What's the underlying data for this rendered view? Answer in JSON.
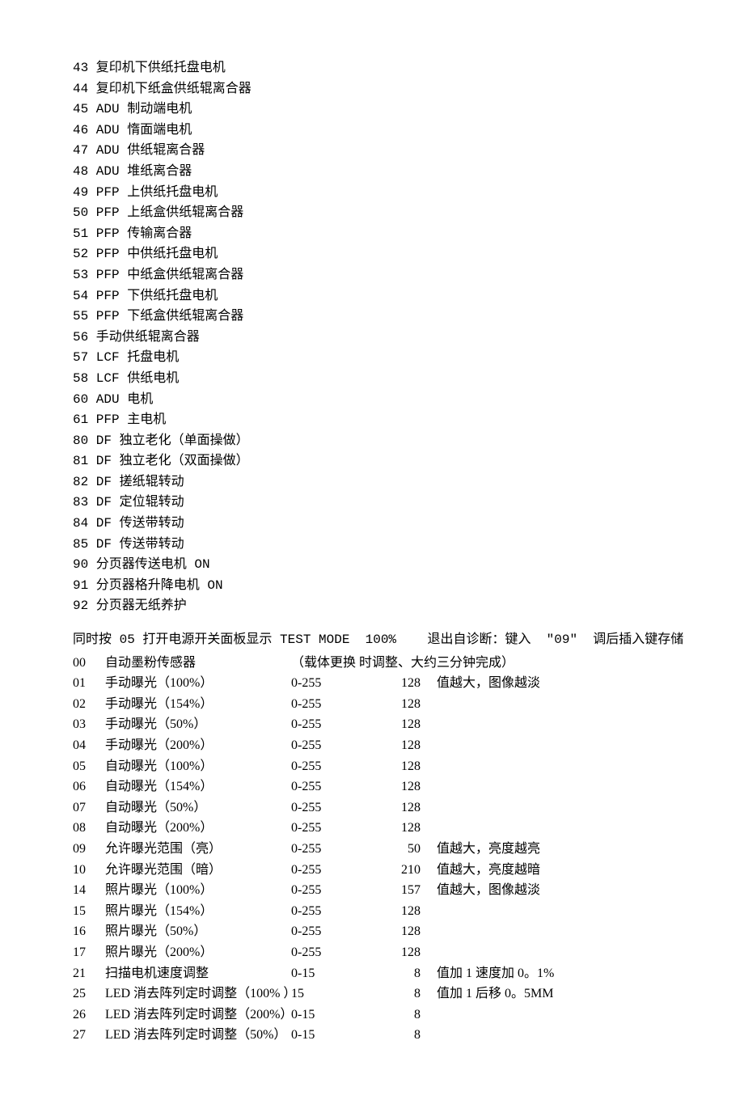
{
  "codes": [
    {
      "num": "43",
      "label": "复印机下供纸托盘电机"
    },
    {
      "num": "44",
      "label": "复印机下纸盒供纸辊离合器"
    },
    {
      "num": "45",
      "label": "ADU 制动端电机"
    },
    {
      "num": "46",
      "label": "ADU 惰面端电机"
    },
    {
      "num": "47",
      "label": "ADU 供纸辊离合器"
    },
    {
      "num": "48",
      "label": "ADU 堆纸离合器"
    },
    {
      "num": "49",
      "label": "PFP 上供纸托盘电机"
    },
    {
      "num": "50",
      "label": "PFP 上纸盒供纸辊离合器"
    },
    {
      "num": "51",
      "label": "PFP 传输离合器"
    },
    {
      "num": "52",
      "label": "PFP 中供纸托盘电机"
    },
    {
      "num": "53",
      "label": "PFP 中纸盒供纸辊离合器"
    },
    {
      "num": "54",
      "label": "PFP 下供纸托盘电机"
    },
    {
      "num": "55",
      "label": "PFP 下纸盒供纸辊离合器"
    },
    {
      "num": "56",
      "label": "手动供纸辊离合器"
    },
    {
      "num": "57",
      "label": "LCF 托盘电机"
    },
    {
      "num": "58",
      "label": "LCF 供纸电机"
    },
    {
      "num": "60",
      "label": "ADU 电机"
    },
    {
      "num": "61",
      "label": "PFP 主电机"
    },
    {
      "num": "80",
      "label": "DF 独立老化（单面操做）"
    },
    {
      "num": "81",
      "label": "DF 独立老化（双面操做）"
    },
    {
      "num": "82",
      "label": "DF 搓纸辊转动"
    },
    {
      "num": "83",
      "label": "DF 定位辊转动"
    },
    {
      "num": "84",
      "label": "DF 传送带转动"
    },
    {
      "num": "85",
      "label": "DF 传送带转动"
    },
    {
      "num": "90",
      "label": "分页器传送电机 ON"
    },
    {
      "num": "91",
      "label": "分页器格升降电机 ON"
    },
    {
      "num": "92",
      "label": "分页器无纸养护"
    }
  ],
  "section_header": "同时按 05 打开电源开关面板显示 TEST MODE  100%    退出自诊断：键入  \"09\"  调后插入键存储",
  "first_row": {
    "code": "00",
    "name": "自动墨粉传感器",
    "remark": "（载体更换  时调整、大约三分钟完成）"
  },
  "params": [
    {
      "code": "01",
      "name": "手动曝光（100%）",
      "range": "0-255",
      "default": "128",
      "remark": "值越大，图像越淡"
    },
    {
      "code": "02",
      "name": "手动曝光（154%）",
      "range": "0-255",
      "default": "128",
      "remark": ""
    },
    {
      "code": "03",
      "name": "手动曝光（50%）",
      "range": "0-255",
      "default": "128",
      "remark": ""
    },
    {
      "code": "04",
      "name": "手动曝光（200%）",
      "range": "0-255",
      "default": "128",
      "remark": ""
    },
    {
      "code": "05",
      "name": "自动曝光（100%）",
      "range": "0-255",
      "default": "128",
      "remark": ""
    },
    {
      "code": "06",
      "name": "自动曝光（154%）",
      "range": "0-255",
      "default": "128",
      "remark": ""
    },
    {
      "code": "07",
      "name": "自动曝光（50%）",
      "range": "0-255",
      "default": "128",
      "remark": ""
    },
    {
      "code": "08",
      "name": "自动曝光（200%）",
      "range": "0-255",
      "default": "128",
      "remark": ""
    },
    {
      "code": "09",
      "name": "允许曝光范围（亮）",
      "range": "0-255",
      "default": "50",
      "remark": "值越大，亮度越亮"
    },
    {
      "code": "10",
      "name": "允许曝光范围（暗）",
      "range": "0-255",
      "default": "210",
      "remark": "值越大，亮度越暗"
    },
    {
      "code": "14",
      "name": "照片曝光（100%）",
      "range": "0-255",
      "default": "157",
      "remark": "值越大，图像越淡"
    },
    {
      "code": "15",
      "name": "照片曝光（154%）",
      "range": "0-255",
      "default": "128",
      "remark": ""
    },
    {
      "code": "16",
      "name": "照片曝光（50%）",
      "range": "0-255",
      "default": "128",
      "remark": ""
    },
    {
      "code": "17",
      "name": "照片曝光（200%）",
      "range": "0-255",
      "default": "128",
      "remark": ""
    },
    {
      "code": "21",
      "name": "扫描电机速度调整",
      "range": "0-15",
      "default": "8",
      "remark": "值加 1 速度加 0。1%"
    },
    {
      "code": "25",
      "name": "LED 消去阵列定时调整（100% ）",
      "range": "15",
      "default": "8",
      "remark": "值加 1 后移 0。5MM"
    },
    {
      "code": "26",
      "name": "LED 消去阵列定时调整（200%）",
      "range": "0-15",
      "default": "8",
      "remark": ""
    },
    {
      "code": "27",
      "name": "LED 消去阵列定时调整（50%）",
      "range": "0-15",
      "default": "8",
      "remark": ""
    }
  ]
}
